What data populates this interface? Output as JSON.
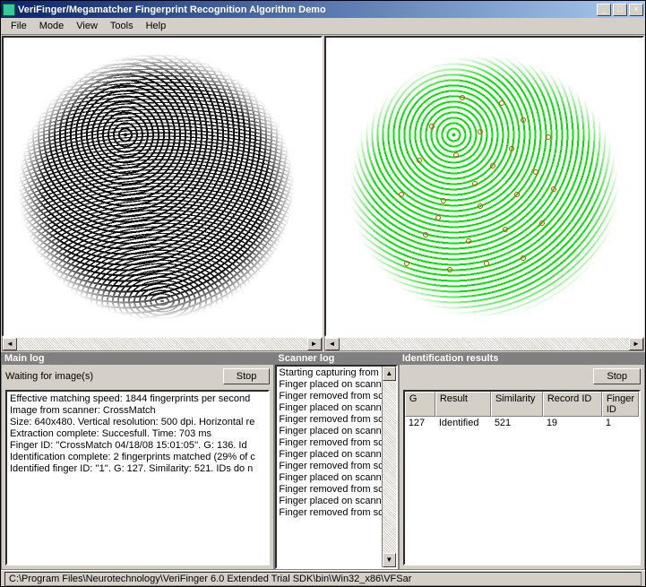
{
  "window": {
    "title": "VeriFinger/Megamatcher Fingerprint Recognition Algorithm Demo",
    "btn_min": "_",
    "btn_max": "□",
    "btn_close": "×"
  },
  "menu": {
    "file": "File",
    "mode": "Mode",
    "view": "View",
    "tools": "Tools",
    "help": "Help"
  },
  "scroll": {
    "left": "◄",
    "right": "►",
    "up": "▲",
    "down": "▼"
  },
  "mainlog": {
    "title": "Main log",
    "waiting": "Waiting for image(s)",
    "stop": "Stop",
    "lines": [
      "Effective matching speed: 1844 fingerprints per second",
      "",
      "Image from scanner: CrossMatch",
      "Size: 640x480. Vertical resolution: 500 dpi. Horizontal re",
      "Extraction complete: Succesfull. Time: 703 ms",
      "Finger ID: ''CrossMatch 04/18/08 15:01:05''. G: 136. Id",
      "Identification complete: 2 fingerprints matched (29% of c",
      "Identified finger ID: ''1''. G: 127. Similarity: 521. IDs do n"
    ]
  },
  "scanlog": {
    "title": "Scanner log",
    "lines": [
      "Starting capturing from sc",
      "Finger placed on scanne",
      "Finger removed from scan",
      "Finger placed on scanne",
      "Finger removed from scan",
      "Finger placed on scanne",
      "Finger removed from scan",
      "Finger placed on scanne",
      "Finger removed from scan",
      "Finger placed on scanne",
      "Finger removed from scan",
      "Finger placed on scanne",
      "Finger removed from scan"
    ]
  },
  "results": {
    "title": "Identification results",
    "stop": "Stop",
    "headers": {
      "g": "G",
      "result": "Result",
      "similarity": "Similarity",
      "record": "Record ID",
      "finger": "Finger ID"
    },
    "row": {
      "g": "127",
      "result": "Identified",
      "similarity": "521",
      "record": "19",
      "finger": "1"
    }
  },
  "status": {
    "path": "C:\\Program Files\\Neurotechnology\\VeriFinger 6.0 Extended Trial SDK\\bin\\Win32_x86\\VFSar"
  }
}
